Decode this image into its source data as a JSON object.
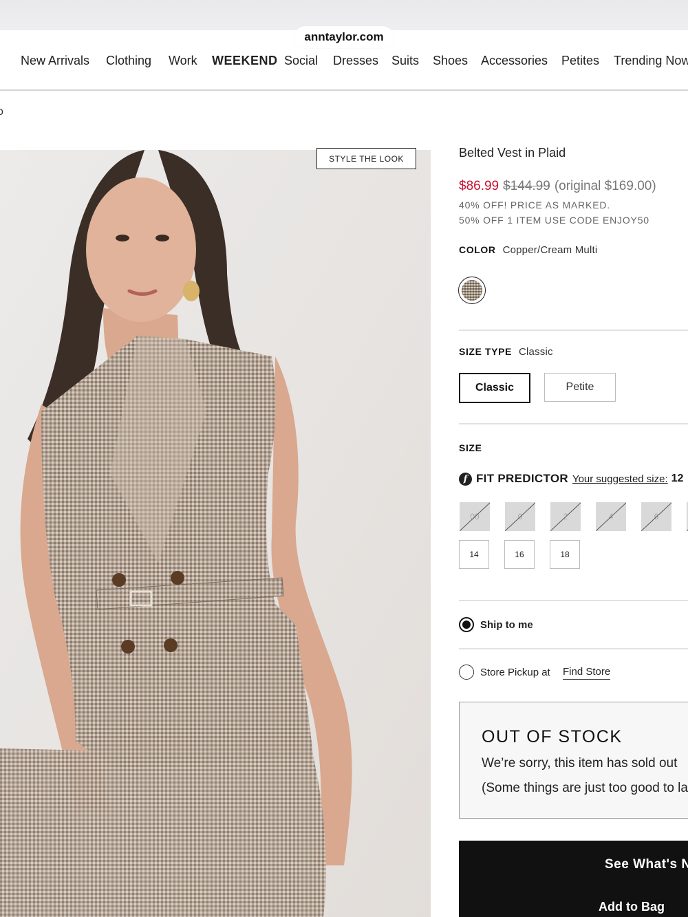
{
  "browser": {
    "url": "anntaylor.com"
  },
  "nav": {
    "items": [
      "New Arrivals",
      "Clothing",
      "Work",
      "WEEKEND",
      "Social",
      "Dresses",
      "Suits",
      "Shoes",
      "Accessories",
      "Petites",
      "Trending Now"
    ]
  },
  "breadcrumb": {
    "text": "o"
  },
  "image": {
    "style_button": "STYLE THE LOOK"
  },
  "product": {
    "title": "Belted Vest in Plaid",
    "price_sale": "$86.99",
    "price_was": "$144.99",
    "price_original": "(original $169.00)",
    "promo1": "40% OFF! PRICE AS MARKED.",
    "promo2": "50% OFF 1 ITEM USE CODE ENJOY50",
    "color_label": "COLOR",
    "color_value": "Copper/Cream Multi",
    "size_type_label": "SIZE TYPE",
    "size_type_value": "Classic",
    "size_type_options": [
      "Classic",
      "Petite"
    ],
    "size_label": "SIZE",
    "fit_predictor": "FIT PREDICTOR",
    "suggested_label": "Your suggested size:",
    "suggested_size": "12",
    "sizes_unavailable": [
      "00",
      "0",
      "2",
      "4",
      "6"
    ],
    "sizes_available": [
      "14",
      "16",
      "18"
    ]
  },
  "delivery": {
    "ship": "Ship to me",
    "pickup": "Store Pickup at",
    "find_store": "Find Store"
  },
  "stock": {
    "heading": "OUT OF STOCK",
    "line1": "We’re sorry, this item has sold out",
    "line2": "(Some things are just too good to last)"
  },
  "cta": {
    "see_whats": "See What's New",
    "add_to_bag": "Add to Bag"
  },
  "colors": {
    "sale": "#c8102e",
    "dark": "#111111"
  }
}
